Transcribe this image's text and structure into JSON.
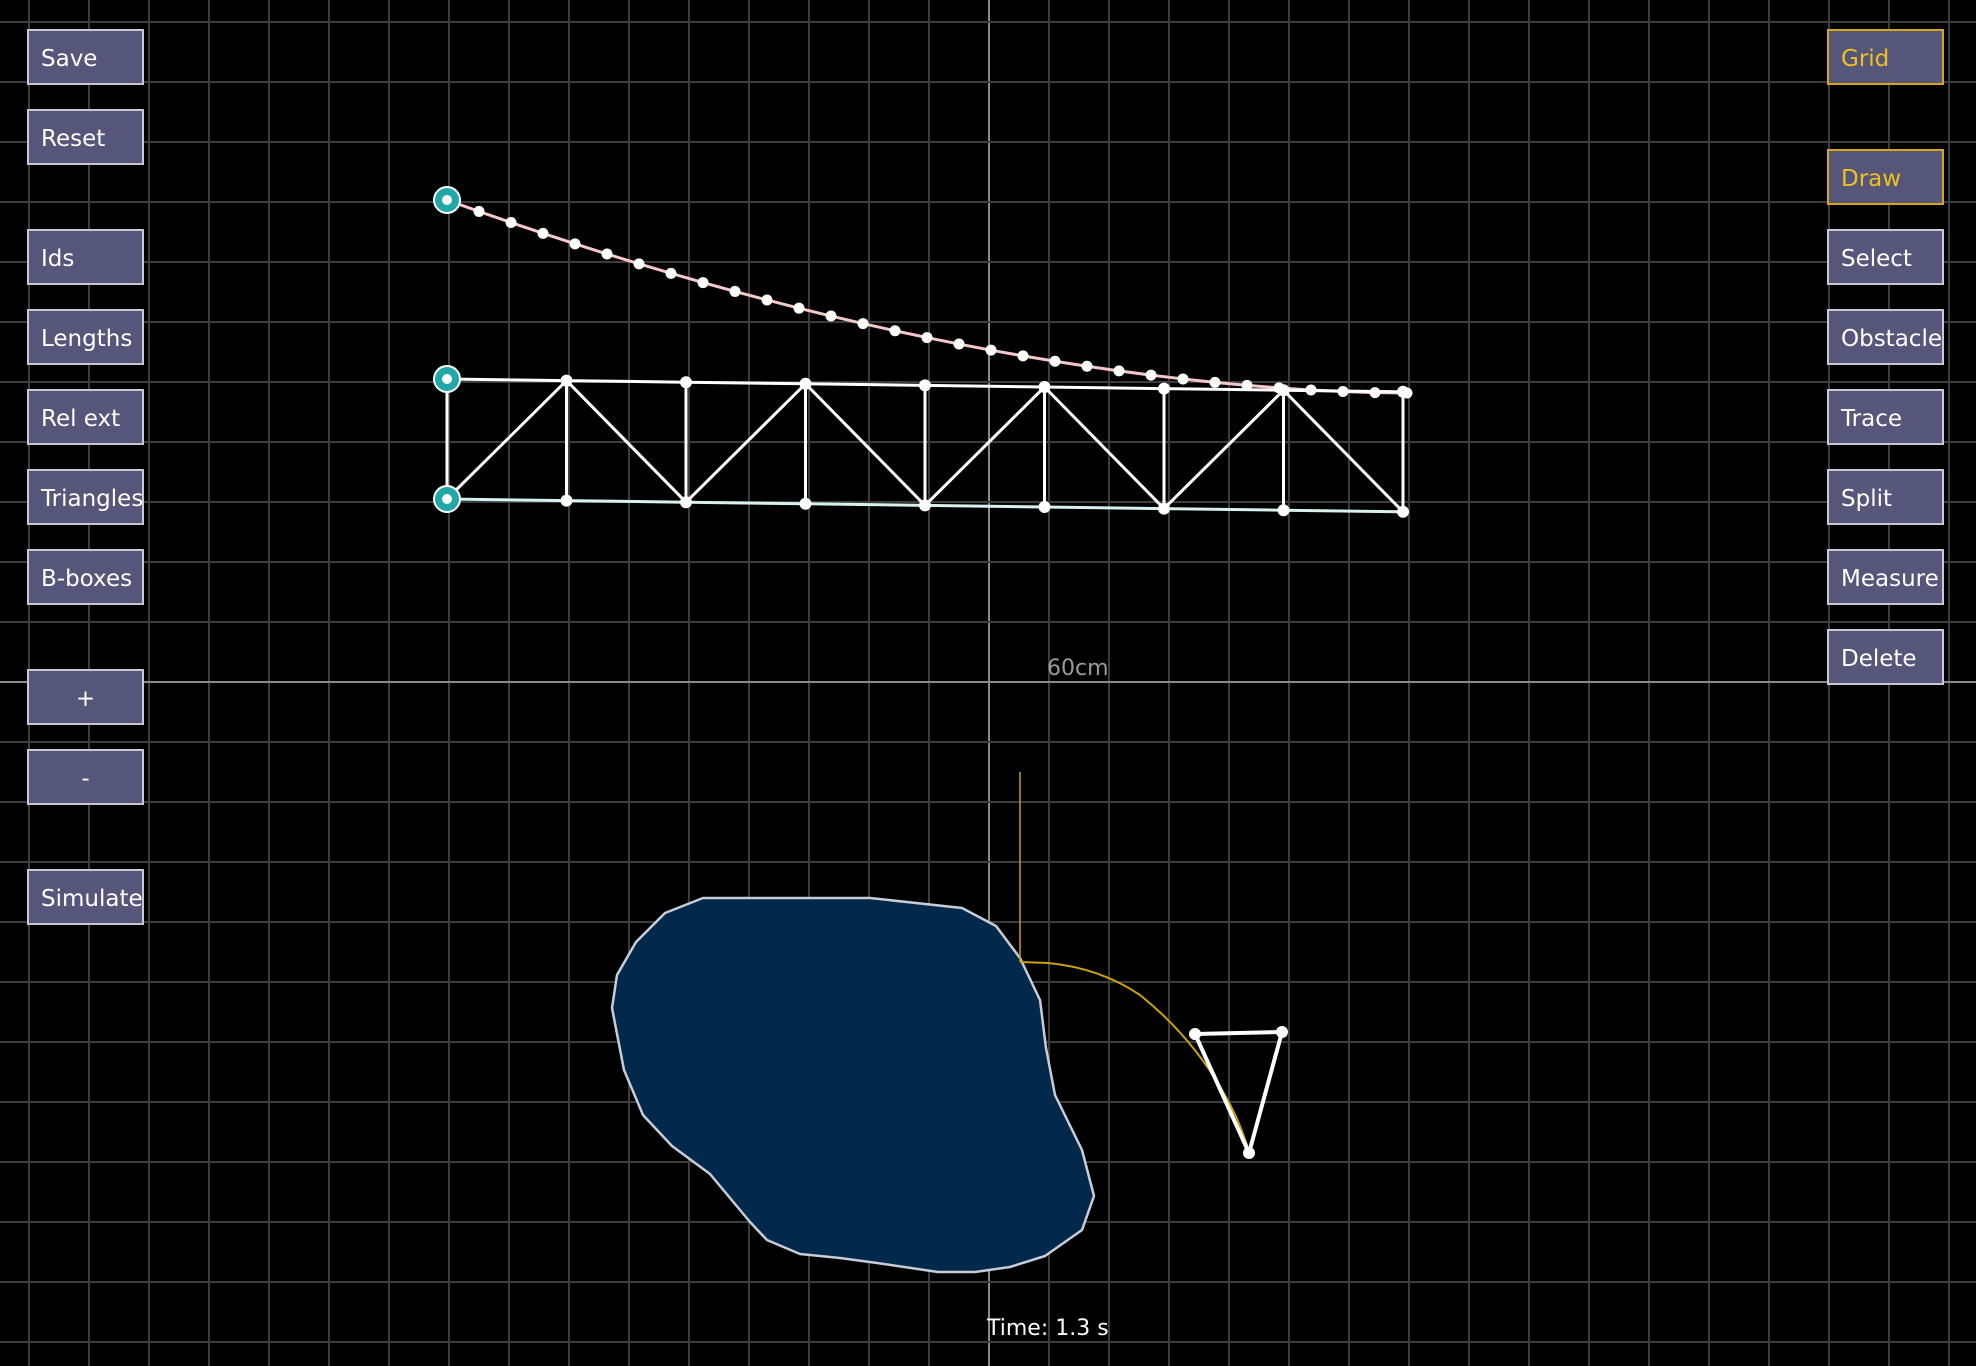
{
  "left_toolbar": {
    "save": "Save",
    "reset": "Reset",
    "ids": "Ids",
    "lengths": "Lengths",
    "rel_ext": "Rel ext",
    "triangles": "Triangles",
    "bboxes": "B-boxes",
    "zoom_in": "+",
    "zoom_out": "-",
    "simulate": "Simulate"
  },
  "right_toolbar": {
    "grid": "Grid",
    "draw": "Draw",
    "select": "Select",
    "obstacle": "Obstacle",
    "trace": "Trace",
    "split": "Split",
    "measure": "Measure",
    "delete": "Delete",
    "active_toggles": [
      "Grid",
      "Draw"
    ]
  },
  "canvas": {
    "scale_label": "60cm",
    "time_label": "Time: 1.3 s"
  },
  "colors": {
    "background": "#000000",
    "grid_line": "#3c3c3c",
    "grid_axis": "#8a8a8a",
    "button_fill": "#55567a",
    "button_border": "#c8c8d4",
    "active_text": "#f0c020",
    "obstacle_fill": "#02284c",
    "obstacle_border": "#c8ccd6",
    "anchor": "#20a8a8",
    "rope": "#f5c8c8",
    "trace_line": "#c8a010"
  }
}
